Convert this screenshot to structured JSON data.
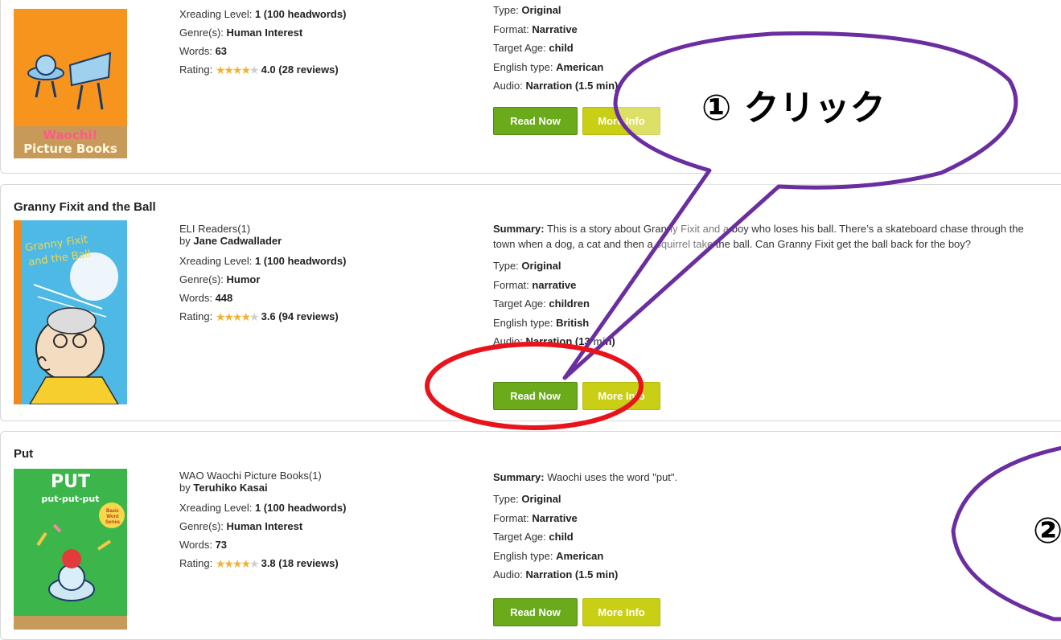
{
  "books": [
    {
      "title": "",
      "series": "",
      "author": "",
      "level_label": "Xreading Level:",
      "level": "1 (100 headwords)",
      "genre_label": "Genre(s):",
      "genre": "Human Interest",
      "words_label": "Words:",
      "words": "63",
      "rating_label": "Rating:",
      "rating_stars": 4,
      "rating": "4.0 (28 reviews)",
      "summary_label": "",
      "summary": "",
      "type_label": "Type:",
      "type": "Original",
      "format_label": "Format:",
      "format": "Narrative",
      "age_label": "Target Age:",
      "age": "child",
      "english_label": "English type:",
      "english": "American",
      "audio_label": "Audio:",
      "audio": "Narration (1.5 min)",
      "read_label": "Read Now",
      "more_label": "More Info",
      "cover_brand": "Waochi!",
      "cover_series": "Picture Books",
      "cover_color": "#f7941d"
    },
    {
      "title": "Granny Fixit and the Ball",
      "series": "ELI Readers(1)",
      "by": "by",
      "author": "Jane Cadwallader",
      "level_label": "Xreading Level:",
      "level": "1 (100 headwords)",
      "genre_label": "Genre(s):",
      "genre": "Humor",
      "words_label": "Words:",
      "words": "448",
      "rating_label": "Rating:",
      "rating_stars": 4,
      "rating": "3.6 (94 reviews)",
      "summary_label": "Summary:",
      "summary": "This is a story about Granny Fixit and a boy who loses his ball. There’s a skateboard chase through the town when a dog, a cat and then a squirrel take the ball. Can Granny Fixit get the ball back for the boy?",
      "type_label": "Type:",
      "type": "Original",
      "format_label": "Format:",
      "format": "narrative",
      "age_label": "Target Age:",
      "age": "children",
      "english_label": "English type:",
      "english": "British",
      "audio_label": "Audio:",
      "audio": "Narration (13 min)",
      "read_label": "Read Now",
      "more_label": "More Info",
      "cover_title_1": "Granny Fixit",
      "cover_title_2": "and the Ball",
      "cover_color": "#4fb9e6"
    },
    {
      "title": "Put",
      "series": "WAO Waochi Picture Books(1)",
      "by": "by",
      "author": "Teruhiko Kasai",
      "level_label": "Xreading Level:",
      "level": "1 (100 headwords)",
      "genre_label": "Genre(s):",
      "genre": "Human Interest",
      "words_label": "Words:",
      "words": "73",
      "rating_label": "Rating:",
      "rating_stars": 4,
      "rating": "3.8 (18 reviews)",
      "summary_label": "Summary:",
      "summary": "Waochi uses the word \"put\".",
      "type_label": "Type:",
      "type": "Original",
      "format_label": "Format:",
      "format": "Narrative",
      "age_label": "Target Age:",
      "age": "child",
      "english_label": "English type:",
      "english": "American",
      "audio_label": "Audio:",
      "audio": "Narration (1.5 min)",
      "read_label": "Read Now",
      "more_label": "More Info",
      "cover_title": "PUT",
      "cover_subtitle": "put-put-put",
      "cover_badge": "Basic Word Series",
      "cover_color": "#3cb54a"
    }
  ],
  "annotations": {
    "callout_1": "① クリック",
    "callout_2": "②",
    "callout_color": "#6a2ea0",
    "highlight_color": "#e8141c"
  }
}
